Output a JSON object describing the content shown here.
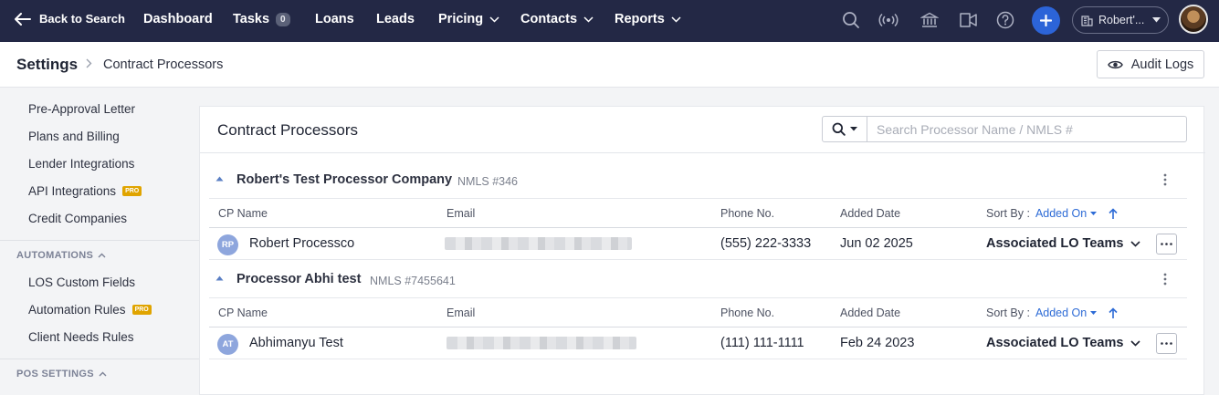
{
  "topnav": {
    "back_label": "Back to Search",
    "items": [
      {
        "label": "Dashboard"
      },
      {
        "label": "Tasks",
        "badge": "0"
      },
      {
        "label": "Loans"
      },
      {
        "label": "Leads"
      },
      {
        "label": "Pricing"
      },
      {
        "label": "Contacts"
      },
      {
        "label": "Reports"
      }
    ],
    "company_label": "Robert'...",
    "icons": [
      "search-icon",
      "broadcast-icon",
      "bank-icon",
      "video-icon",
      "help-icon",
      "plus-icon",
      "building-icon",
      "user-avatar"
    ],
    "accent": "#2c64d8",
    "bg": "#232845"
  },
  "breadcrumb": {
    "title": "Settings",
    "current": "Contract Processors"
  },
  "audit_logs_label": "Audit Logs",
  "sidebar": {
    "items_top": [
      {
        "label": "Pre-Approval Letter"
      },
      {
        "label": "Plans and Billing"
      },
      {
        "label": "Lender Integrations"
      },
      {
        "label": "API Integrations",
        "pro": "PRO"
      },
      {
        "label": "Credit Companies"
      }
    ],
    "automations_header": "AUTOMATIONS",
    "automations_items": [
      {
        "label": "LOS Custom Fields"
      },
      {
        "label": "Automation Rules",
        "pro": "PRO"
      },
      {
        "label": "Client Needs Rules"
      }
    ],
    "pos_header": "POS SETTINGS"
  },
  "main": {
    "title": "Contract Processors",
    "search_placeholder": "Search Processor Name / NMLS #",
    "columns": {
      "name": "CP Name",
      "email": "Email",
      "phone": "Phone No.",
      "added": "Added Date",
      "sort_by": "Sort By :",
      "sort_value": "Added On"
    },
    "groups": [
      {
        "name": "Robert's Test Processor Company",
        "nmls": "NMLS #346",
        "rows": [
          {
            "initials": "RP",
            "name": "Robert Processco",
            "phone": "(555) 222-3333",
            "added": "Jun 02 2025",
            "teams": "Associated LO Teams"
          }
        ]
      },
      {
        "name": "Processor Abhi test",
        "nmls": "NMLS #7455641",
        "rows": [
          {
            "initials": "AT",
            "name": "Abhimanyu Test",
            "phone": "(111) 111-1111",
            "added": "Feb 24 2023",
            "teams": "Associated LO Teams"
          }
        ]
      }
    ]
  }
}
